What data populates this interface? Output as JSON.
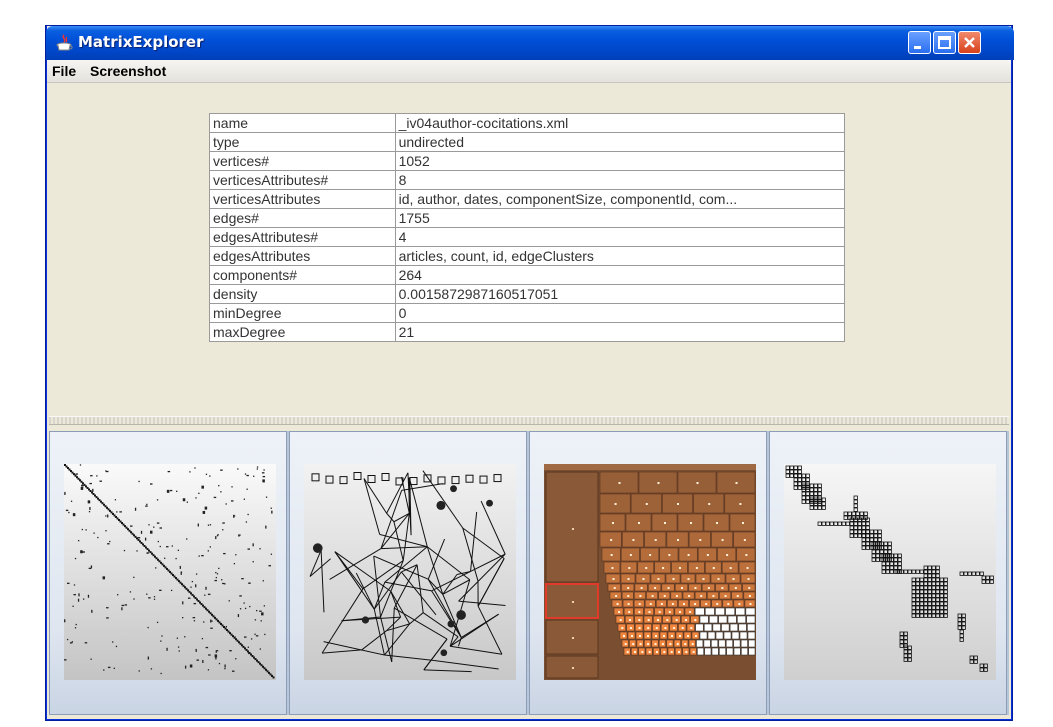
{
  "window": {
    "title": "MatrixExplorer"
  },
  "menu": {
    "items": [
      "File",
      "Screenshot"
    ]
  },
  "properties": [
    {
      "key": "name",
      "value": "_iv04author-cocitations.xml"
    },
    {
      "key": "type",
      "value": "undirected"
    },
    {
      "key": "vertices#",
      "value": "1052"
    },
    {
      "key": "verticesAttributes#",
      "value": "8"
    },
    {
      "key": "verticesAttributes",
      "value": "id, author, dates, componentSize, componentId, com..."
    },
    {
      "key": "edges#",
      "value": "1755"
    },
    {
      "key": "edgesAttributes#",
      "value": "4"
    },
    {
      "key": "edgesAttributes",
      "value": "articles, count, id, edgeClusters"
    },
    {
      "key": "components#",
      "value": "264"
    },
    {
      "key": "density",
      "value": "0.0015872987160517051"
    },
    {
      "key": "minDegree",
      "value": "0"
    },
    {
      "key": "maxDegree",
      "value": "21"
    }
  ],
  "thumbnails": [
    {
      "kind": "matrix-view"
    },
    {
      "kind": "node-link-view"
    },
    {
      "kind": "treemap-view"
    },
    {
      "kind": "component-matrix-view"
    }
  ],
  "colors": {
    "titlebar": "#0050d8",
    "treemap_brown": "#8a5a38",
    "treemap_orange": "#e8843a",
    "selection": "#e03a2a"
  }
}
